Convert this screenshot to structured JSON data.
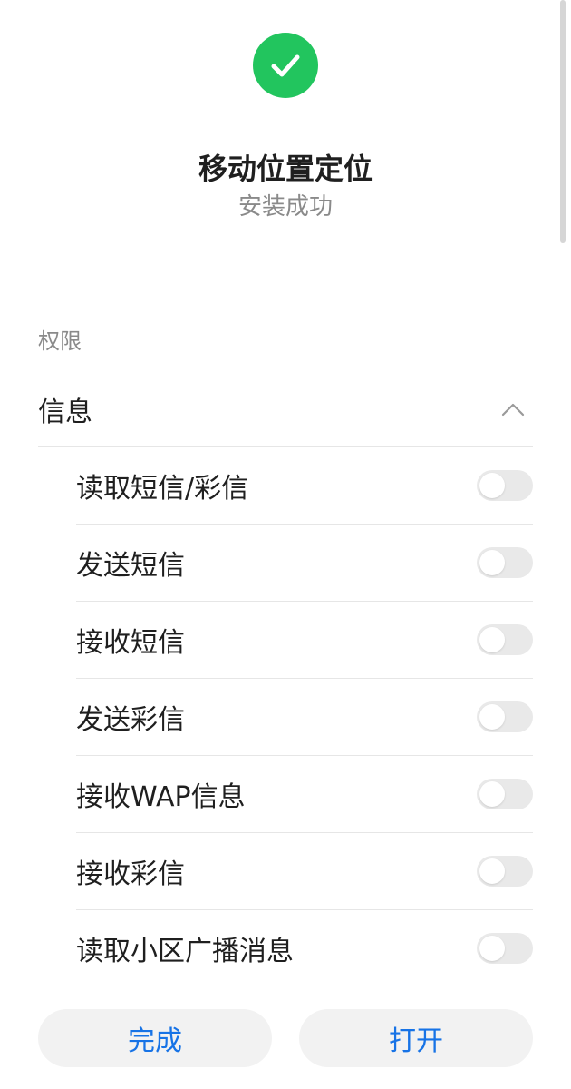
{
  "app": {
    "title": "移动位置定位",
    "status": "安装成功",
    "icon": "check-circle-icon",
    "accent_color": "#22c55e"
  },
  "permissions": {
    "section_label": "权限",
    "group": {
      "label": "信息",
      "expanded": true,
      "icon": "chevron-up-icon"
    },
    "items": [
      {
        "label": "读取短信/彩信",
        "enabled": false
      },
      {
        "label": "发送短信",
        "enabled": false
      },
      {
        "label": "接收短信",
        "enabled": false
      },
      {
        "label": "发送彩信",
        "enabled": false
      },
      {
        "label": "接收WAP信息",
        "enabled": false
      },
      {
        "label": "接收彩信",
        "enabled": false
      },
      {
        "label": "读取小区广播消息",
        "enabled": false
      }
    ]
  },
  "actions": {
    "done_label": "完成",
    "open_label": "打开",
    "button_text_color": "#1773e6"
  }
}
